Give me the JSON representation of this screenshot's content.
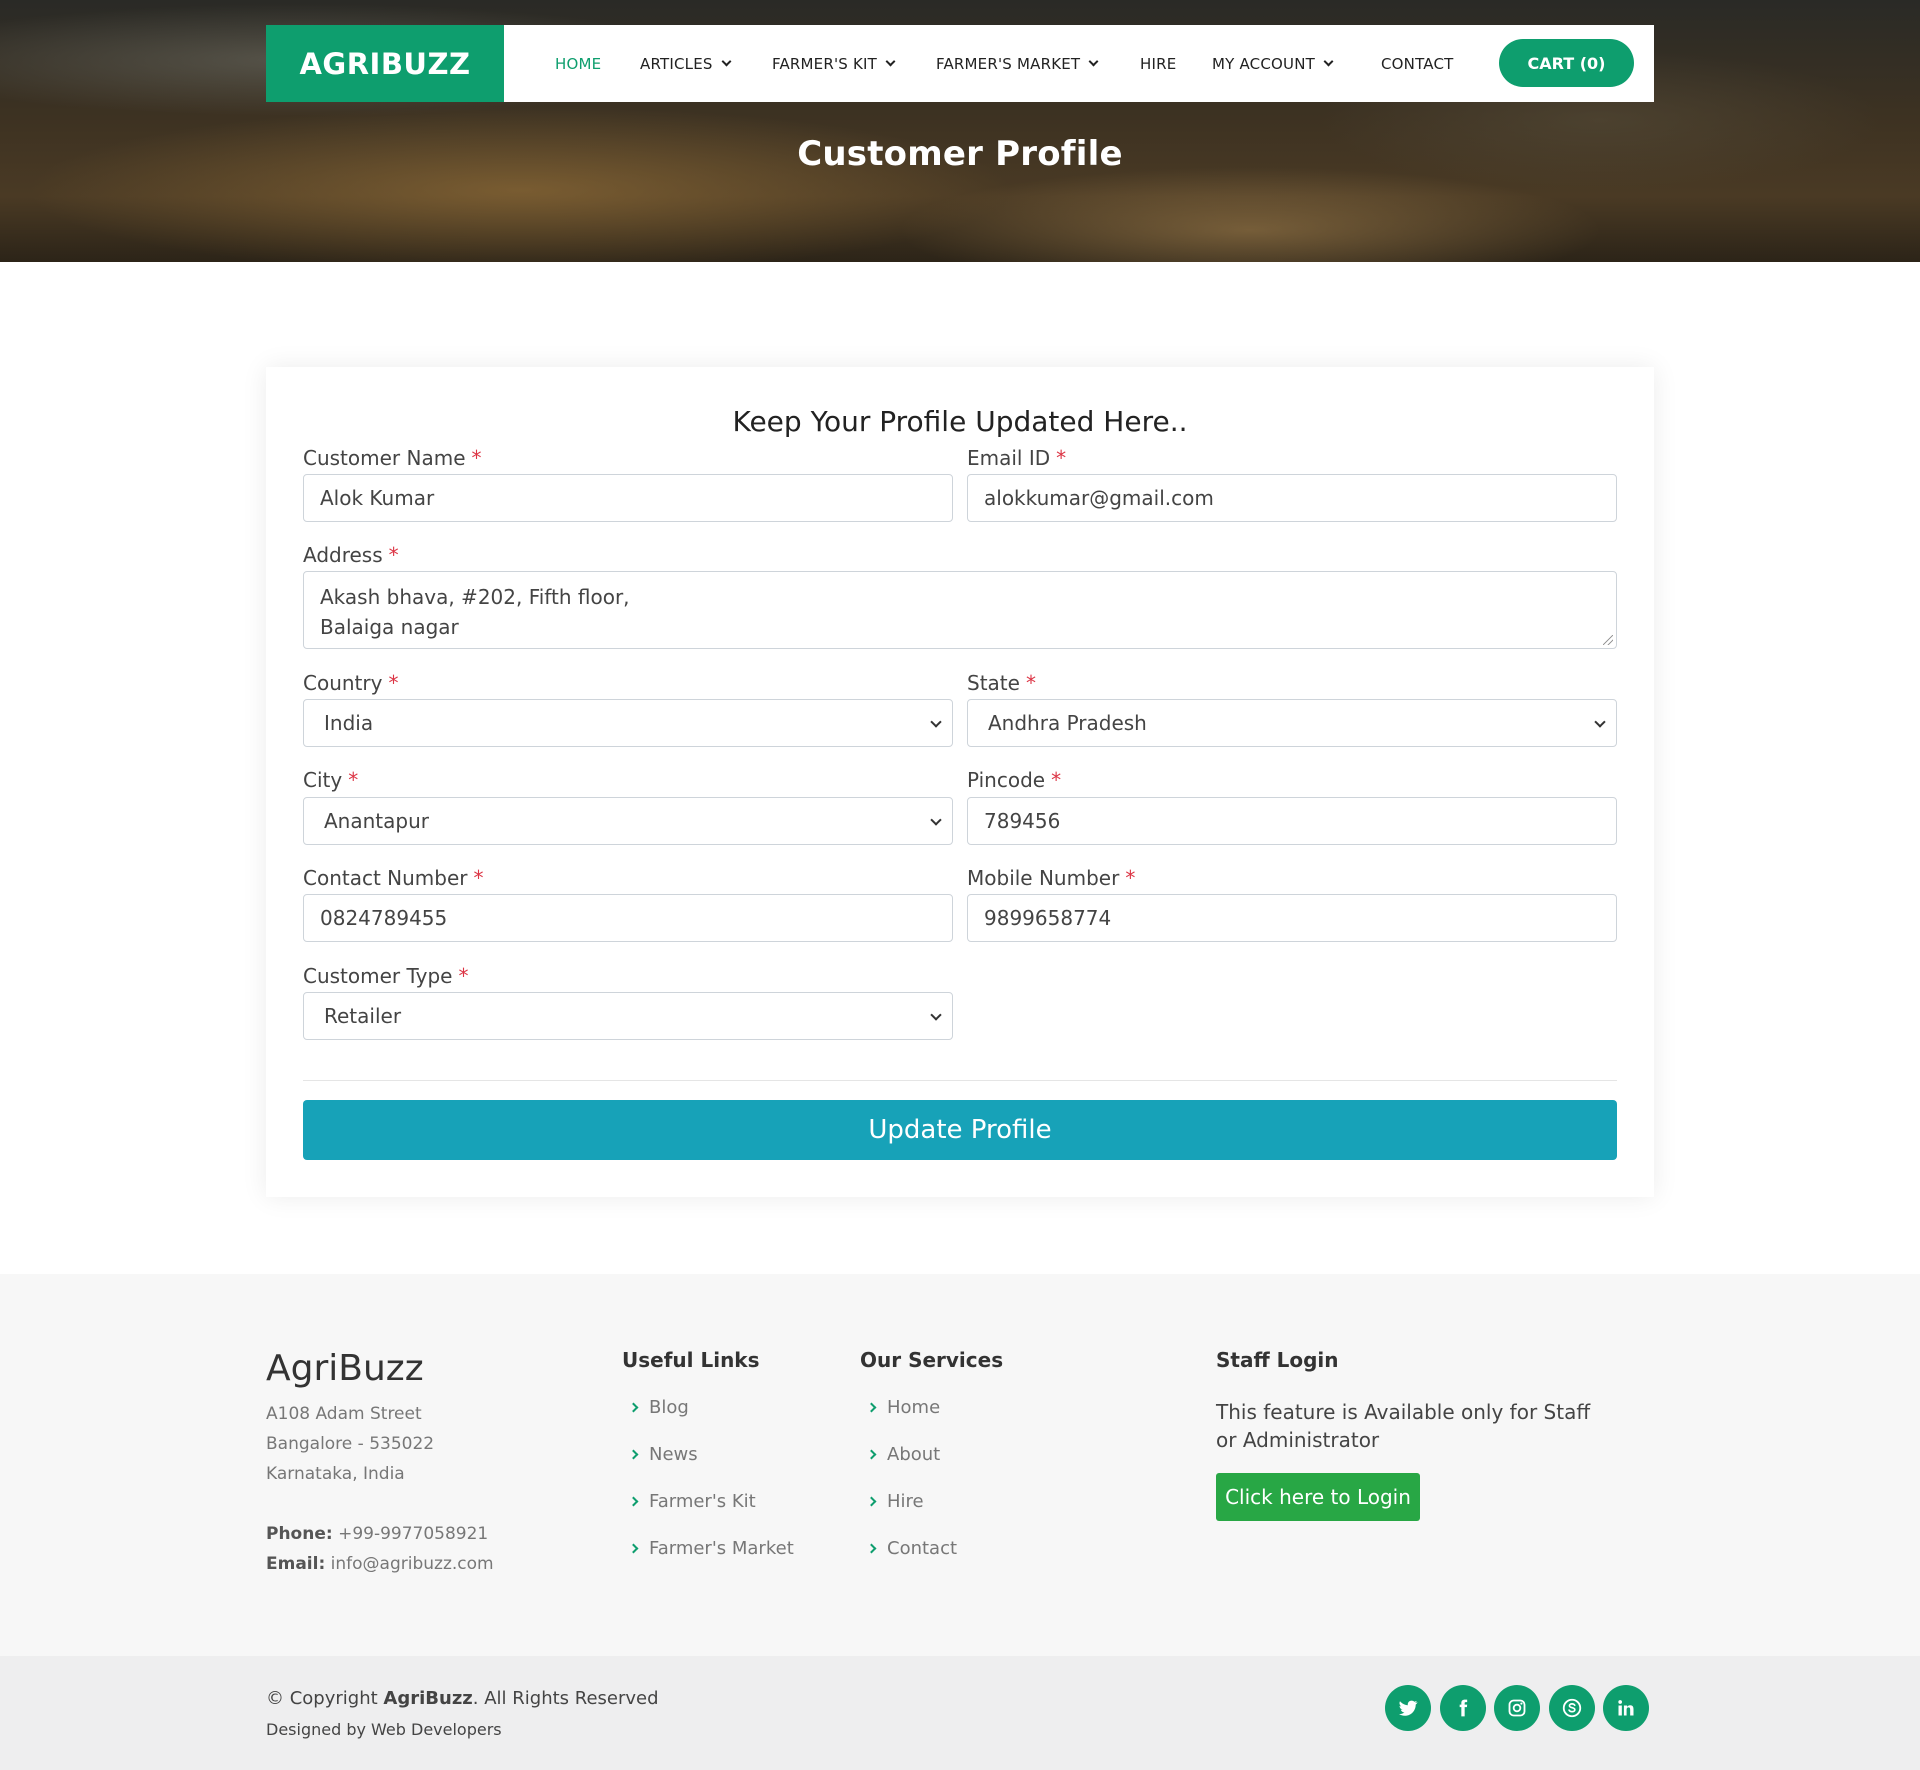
{
  "brand": "AGRIBUZZ",
  "nav": {
    "items": [
      {
        "label": "HOME",
        "active": true,
        "dropdown": false
      },
      {
        "label": "ARTICLES",
        "dropdown": true
      },
      {
        "label": "FARMER'S KIT",
        "dropdown": true
      },
      {
        "label": "FARMER'S MARKET",
        "dropdown": true
      },
      {
        "label": "HIRE",
        "dropdown": false
      },
      {
        "label": "MY ACCOUNT",
        "dropdown": true
      },
      {
        "label": "CONTACT",
        "dropdown": false
      }
    ],
    "cart_label": "CART (0)"
  },
  "hero": {
    "title": "Customer Profile"
  },
  "form": {
    "heading": "Keep Your Profile Updated Here..",
    "required_mark": "*",
    "customer_name": {
      "label": "Customer Name",
      "value": "Alok Kumar"
    },
    "email": {
      "label": "Email ID",
      "value": "alokkumar@gmail.com"
    },
    "address": {
      "label": "Address",
      "line1": "Akash bhava, #202, Fifth floor,",
      "line2": "Balaiga nagar"
    },
    "country": {
      "label": "Country",
      "value": "India"
    },
    "state": {
      "label": "State",
      "value": "Andhra Pradesh"
    },
    "city": {
      "label": "City",
      "value": "Anantapur"
    },
    "pincode": {
      "label": "Pincode",
      "value": "789456"
    },
    "contact_number": {
      "label": "Contact Number",
      "value": "0824789455"
    },
    "mobile_number": {
      "label": "Mobile Number",
      "value": "9899658774"
    },
    "customer_type": {
      "label": "Customer Type",
      "value": "Retailer"
    },
    "submit_label": "Update Profile"
  },
  "footer": {
    "brand": "AgriBuzz",
    "address_lines": [
      "A108 Adam Street",
      "Bangalore - 535022",
      "Karnataka, India"
    ],
    "phone_label": "Phone:",
    "phone": "+99-9977058921",
    "email_label": "Email:",
    "email": "info@agribuzz.com",
    "useful_links": {
      "title": "Useful Links",
      "items": [
        "Blog",
        "News",
        "Farmer's Kit",
        "Farmer's Market"
      ]
    },
    "services": {
      "title": "Our Services",
      "items": [
        "Home",
        "About",
        "Hire",
        "Contact"
      ]
    },
    "staff": {
      "title": "Staff Login",
      "text": "This feature is Available only for Staff or Administrator",
      "button": "Click here to Login"
    },
    "copyright_prefix": "© Copyright",
    "copyright_brand": "AgriBuzz",
    "copyright_suffix": ". All Rights Reserved",
    "designed_by": "Designed by Web Developers",
    "social_icons": [
      "twitter-icon",
      "facebook-icon",
      "instagram-icon",
      "skype-icon",
      "linkedin-icon"
    ]
  },
  "colors": {
    "accent": "#0e9e6e",
    "update_button": "#17a2b8",
    "login_button": "#28a745",
    "required": "#dc3545"
  }
}
